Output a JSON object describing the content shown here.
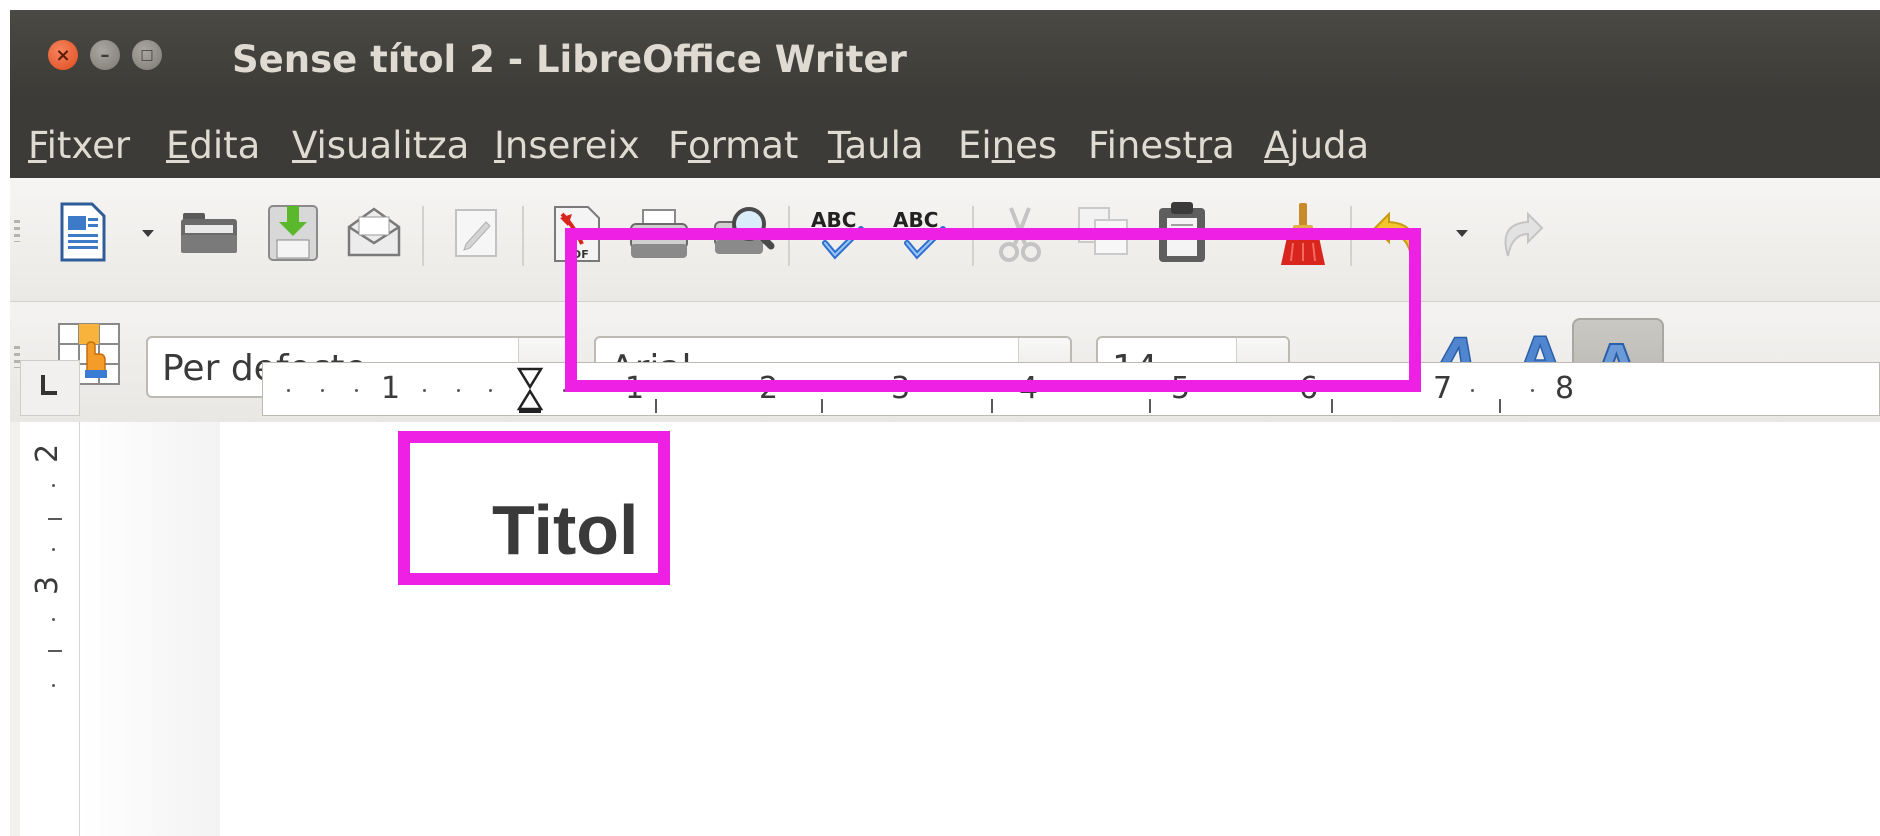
{
  "window": {
    "title": "Sense títol 2 - LibreOffice Writer",
    "controls": {
      "close": "×",
      "minimize": "–",
      "maximize": "□"
    }
  },
  "menu": [
    {
      "label": "Fitxer",
      "mnemonic": "F",
      "rest": "itxer",
      "pre": ""
    },
    {
      "label": "Edita",
      "mnemonic": "E",
      "rest": "dita",
      "pre": ""
    },
    {
      "label": "Visualitza",
      "mnemonic": "V",
      "rest": "isualitza",
      "pre": ""
    },
    {
      "label": "Insereix",
      "mnemonic": "I",
      "rest": "nsereix",
      "pre": ""
    },
    {
      "label": "Format",
      "pre": "F",
      "mnemonic": "o",
      "rest": "rmat"
    },
    {
      "label": "Taula",
      "mnemonic": "T",
      "rest": "aula",
      "pre": ""
    },
    {
      "label": "Eines",
      "pre": "Ei",
      "mnemonic": "n",
      "rest": "es"
    },
    {
      "label": "Finestra",
      "pre": "Finest",
      "mnemonic": "r",
      "rest": "a"
    },
    {
      "label": "Ajuda",
      "mnemonic": "A",
      "rest": "juda",
      "pre": ""
    }
  ],
  "toolbar": {
    "icons": [
      "new-document-icon",
      "open-icon",
      "save-icon",
      "email-icon",
      "edit-file-icon",
      "export-pdf-icon",
      "print-icon",
      "print-preview-icon",
      "spellcheck-icon",
      "autospellcheck-icon",
      "cut-icon",
      "copy-icon",
      "paste-icon",
      "clone-formatting-icon",
      "undo-icon",
      "redo-icon"
    ],
    "spell_label": "ABC"
  },
  "formatting": {
    "paragraph_style": "Per defecte",
    "font_name": "Arial",
    "font_size": "14",
    "shadow_label": "A",
    "italic_label": "A",
    "outline_label": "A"
  },
  "ruler": {
    "horizontal_numbers": [
      "1",
      "1",
      "2",
      "3",
      "4",
      "5",
      "6",
      "7",
      "8"
    ],
    "vertical_numbers": [
      "2",
      "3"
    ]
  },
  "document": {
    "title_text": "Titol"
  },
  "colors": {
    "highlight": "#ee20e3",
    "titlebar": "#3c3b37",
    "close_button": "#df4a1c"
  }
}
